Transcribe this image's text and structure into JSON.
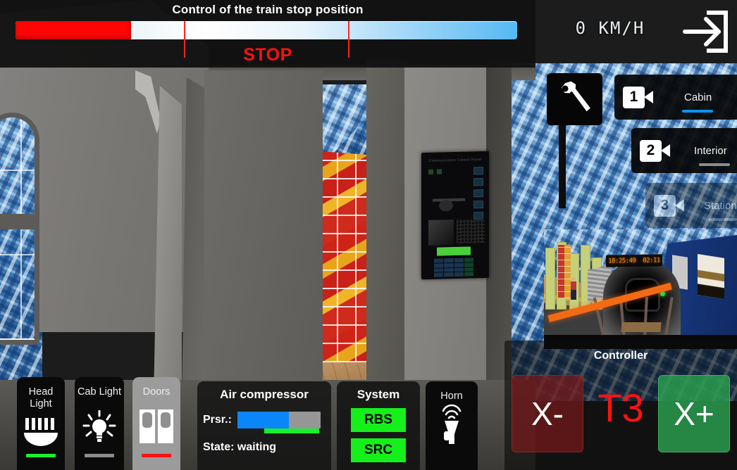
{
  "top": {
    "title": "Control of the train stop position",
    "stop_label": "STOP",
    "speed": "0 KM/H",
    "exit_icon": "exit-arrow-icon"
  },
  "stop_bar": {
    "fill_percent": 23,
    "tick_percent_1": 33.6,
    "tick_percent_2": 66.3,
    "fill_color": "#fb0505",
    "tick_color": "#ff2424"
  },
  "cameras": [
    {
      "number": "1",
      "label": "Cabin",
      "icon": "camera-icon",
      "active": true,
      "underline_color": "#0b93f4"
    },
    {
      "number": "2",
      "label": "Interior",
      "icon": "camera-icon",
      "active": false,
      "underline_color": "#8c8c8c"
    },
    {
      "number": "3",
      "label": "Station",
      "icon": "camera-icon",
      "active": false,
      "underline_color": "#8c8c8c"
    }
  ],
  "switches": [
    {
      "label": "Head\nLight",
      "label_line1": "Head",
      "label_line2": "Light",
      "icon": "headlight-icon",
      "indicator_color": "#18ef2f",
      "state": "on"
    },
    {
      "label": "Cab Light",
      "icon": "bulb-icon",
      "indicator_color": "#8c8c8c",
      "state": "off"
    },
    {
      "label": "Doors",
      "icon": "doors-icon",
      "indicator_color": "#ff1111",
      "state": "closed"
    }
  ],
  "air_compressor": {
    "title": "Air compressor",
    "pressure_key": "Prsr.:",
    "pressure_percent": 62,
    "pressure_color": "#0b86f8",
    "marker_color": "#18ef2f",
    "state_text": "State: waiting"
  },
  "system": {
    "title": "System",
    "buttons": [
      {
        "label": "RBS",
        "color": "#16f01a"
      },
      {
        "label": "SRC",
        "color": "#16f01a"
      }
    ]
  },
  "horn": {
    "label": "Horn",
    "icon": "horn-icon"
  },
  "controller": {
    "title": "Controller",
    "decrease_label": "X-",
    "increase_label": "X+",
    "value": "T3",
    "value_color": "#ff1111",
    "decrease_color": "#781a1a",
    "increase_color": "#2ba04f"
  },
  "scene": {
    "station_display": "18:25:49  02:11",
    "signpost_icon": "wrench-icon",
    "comm_panel_title": "Communication Control Panel"
  }
}
